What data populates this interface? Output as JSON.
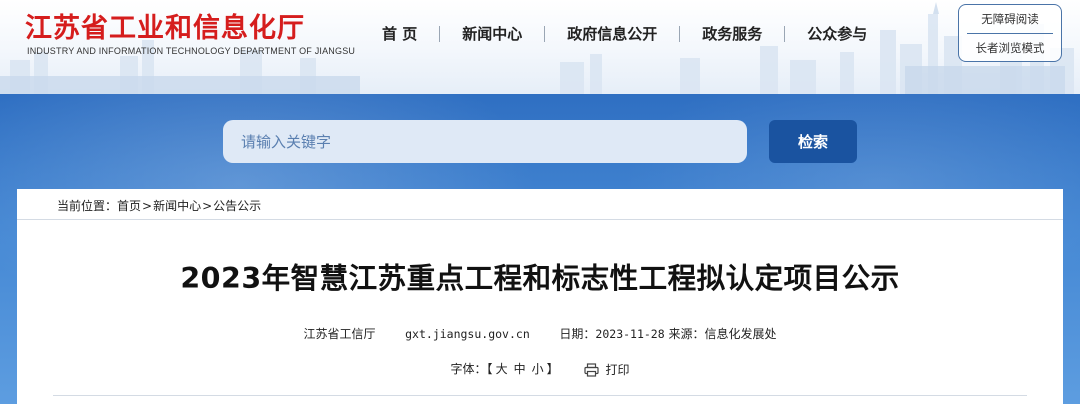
{
  "site": {
    "title_cn": "江苏省工业和信息化厅",
    "title_en": "INDUSTRY AND INFORMATION TECHNOLOGY DEPARTMENT OF JIANGSU"
  },
  "nav": {
    "items": [
      {
        "label": "首 页"
      },
      {
        "label": "新闻中心"
      },
      {
        "label": "政府信息公开"
      },
      {
        "label": "政务服务"
      },
      {
        "label": "公众参与"
      }
    ]
  },
  "accessibility": {
    "barrier_free": "无障碍阅读",
    "elder_mode": "长者浏览模式"
  },
  "search": {
    "placeholder": "请输入关键字",
    "button_label": "检索"
  },
  "breadcrumb": {
    "prefix": "当前位置：",
    "items": [
      "首页",
      "新闻中心",
      "公告公示"
    ],
    "separator": ">"
  },
  "article": {
    "title": "2023年智慧江苏重点工程和标志性工程拟认定项目公示",
    "source_org": "江苏省工信厅",
    "site_url": "gxt.jiangsu.gov.cn",
    "date_label": "日期：",
    "date": "2023-11-28",
    "origin_label": "来源：",
    "origin": "信息化发展处"
  },
  "tools": {
    "font_label": "字体：",
    "bracket_open": "【",
    "bracket_close": "】",
    "size_large": "大",
    "size_medium": "中",
    "size_small": "小",
    "print_label": "打印"
  },
  "colors": {
    "brand_red": "#d51d1d",
    "band_blue": "#3a79c7",
    "button_blue": "#1a53a0"
  }
}
